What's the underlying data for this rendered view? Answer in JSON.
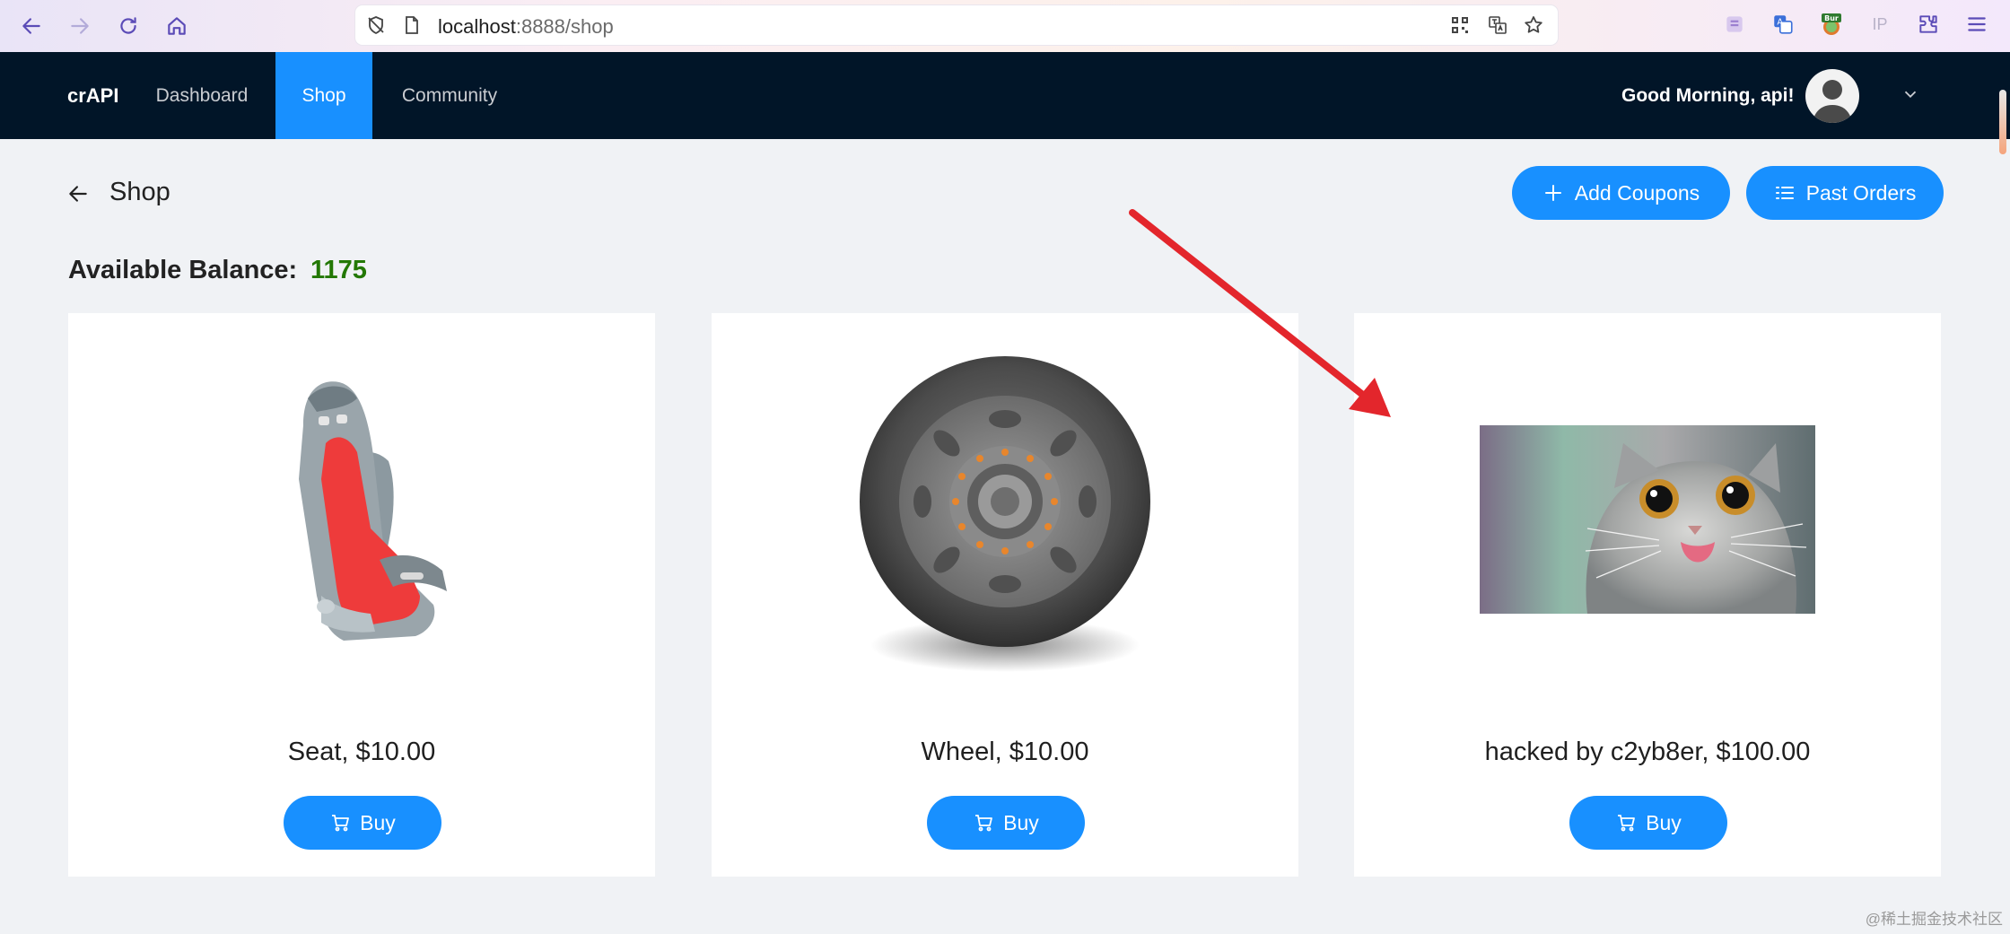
{
  "browser": {
    "url_host": "localhost",
    "url_path": ":8888/shop",
    "ext_burp_label": "Bur",
    "ext_ip_label": "IP"
  },
  "header": {
    "brand": "crAPI",
    "nav": [
      {
        "label": "Dashboard",
        "active": false
      },
      {
        "label": "Shop",
        "active": true
      },
      {
        "label": "Community",
        "active": false
      }
    ],
    "greeting": "Good Morning, api!"
  },
  "page": {
    "title": "Shop",
    "add_coupons_label": "Add Coupons",
    "past_orders_label": "Past Orders",
    "balance_label": "Available Balance:",
    "balance_value": "1175"
  },
  "products": [
    {
      "label": "Seat, $10.00",
      "buy_label": "Buy"
    },
    {
      "label": "Wheel, $10.00",
      "buy_label": "Buy"
    },
    {
      "label": "hacked by c2yb8er, $100.00",
      "buy_label": "Buy"
    }
  ],
  "watermark": "@稀土掘金技术社区",
  "colors": {
    "accent": "#1890ff",
    "header_bg": "#011528",
    "balance": "#237804",
    "annotation_arrow": "#e3262c"
  }
}
